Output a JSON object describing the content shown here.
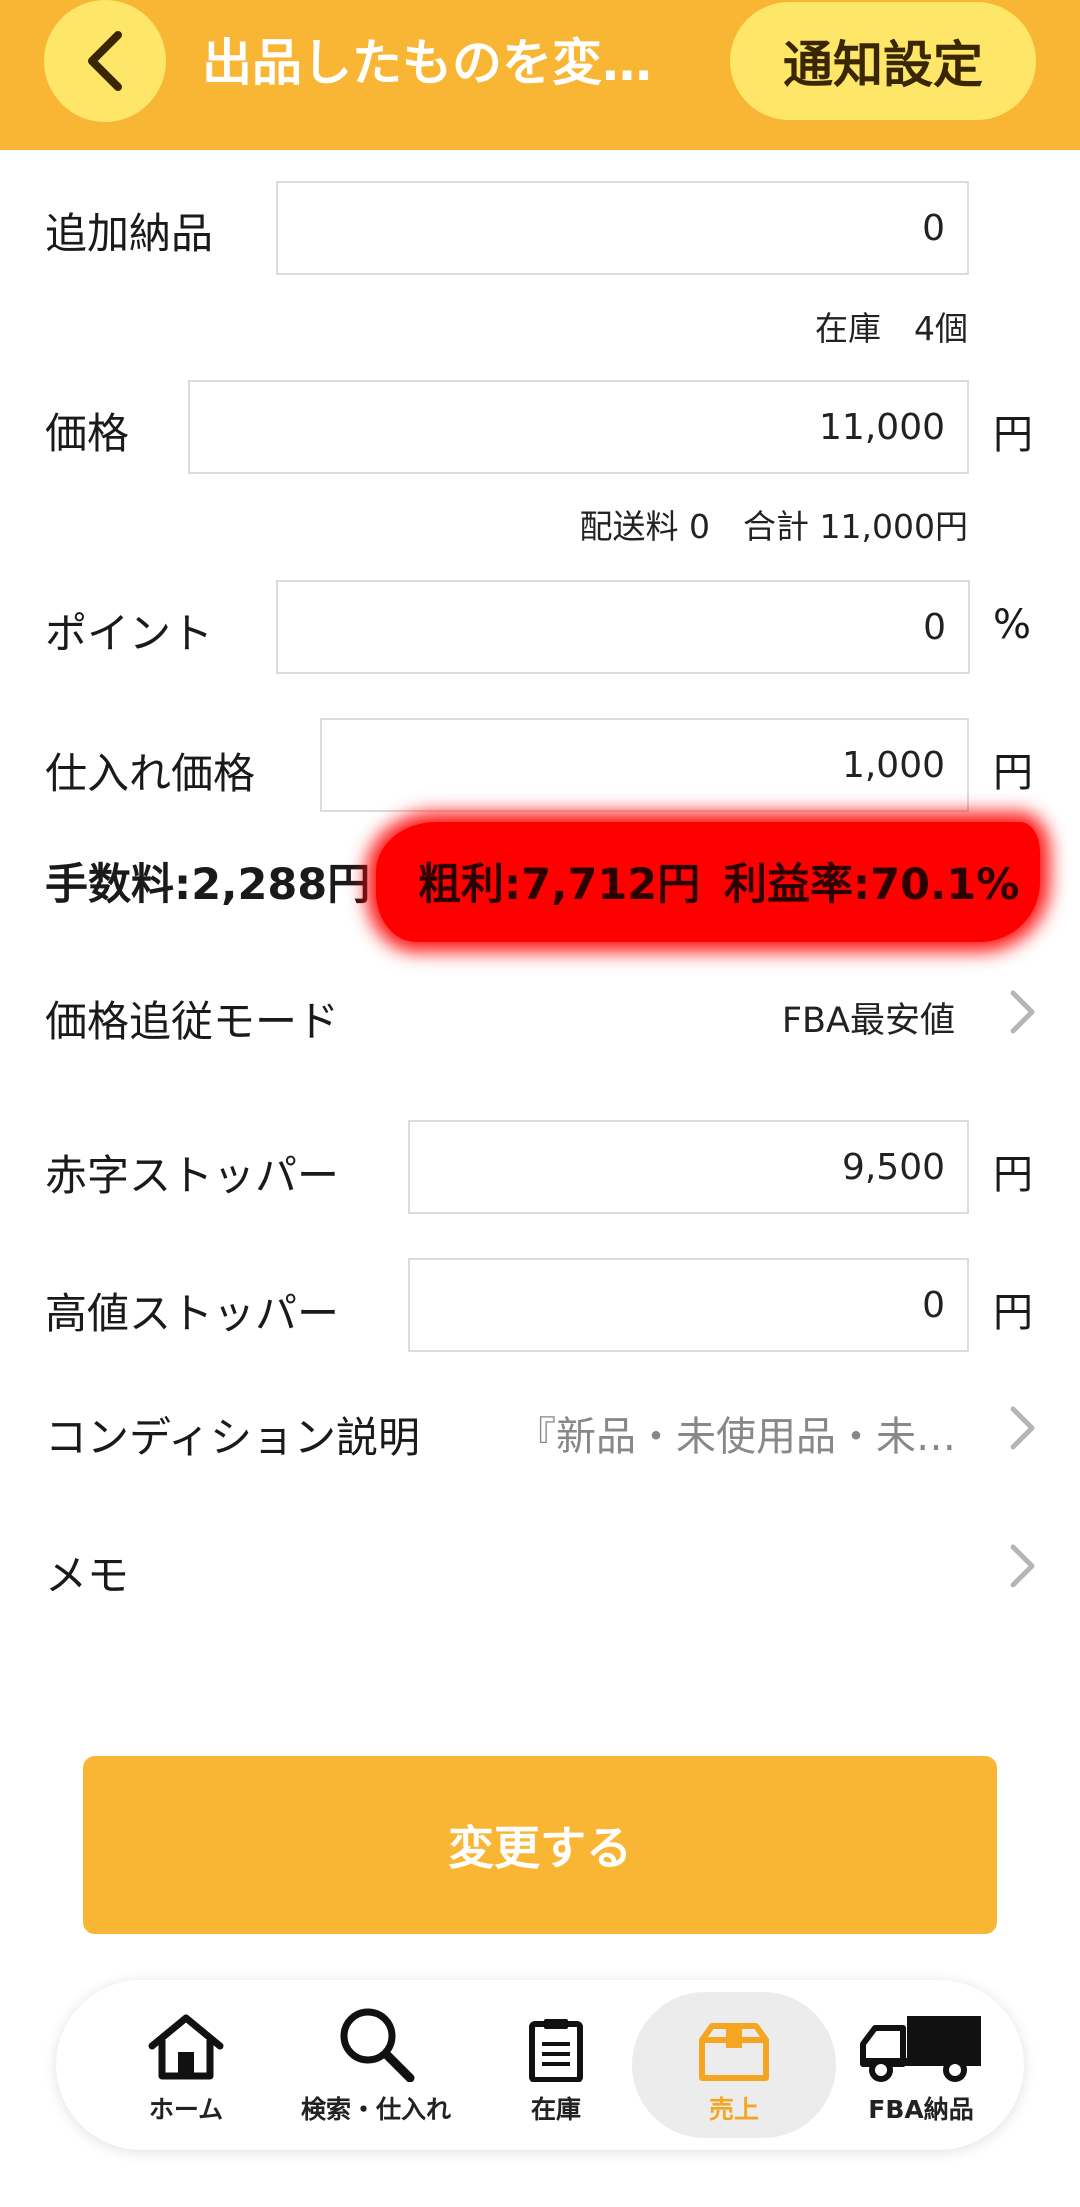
{
  "header": {
    "title": "出品したものを変…",
    "notify_label": "通知設定"
  },
  "form": {
    "additional": {
      "label": "追加納品",
      "value": "0"
    },
    "stock_note": "在庫　4個",
    "price": {
      "label": "価格",
      "value": "11,000",
      "unit": "円"
    },
    "price_note": "配送料 0　合計 11,000円",
    "points": {
      "label": "ポイント",
      "value": "0",
      "unit": "%"
    },
    "purchase": {
      "label": "仕入れ価格",
      "value": "1,000",
      "unit": "円"
    },
    "fee": "手数料:2,288円",
    "gross_profit": "粗利:7,712円",
    "profit_rate": "利益率:70.1%",
    "tracking": {
      "label": "価格追従モード",
      "value": "FBA最安値"
    },
    "loss_stopper": {
      "label": "赤字ストッパー",
      "value": "9,500",
      "unit": "円"
    },
    "high_stopper": {
      "label": "高値ストッパー",
      "value": "0",
      "unit": "円"
    },
    "condition": {
      "label": "コンディション説明",
      "value": "『新品・未使用品・未…"
    },
    "memo": {
      "label": "メモ"
    }
  },
  "submit_label": "変更する",
  "nav": {
    "items": [
      {
        "label": "ホーム",
        "icon": "home-icon"
      },
      {
        "label": "検索・仕入れ",
        "icon": "search-icon"
      },
      {
        "label": "在庫",
        "icon": "clipboard-icon"
      },
      {
        "label": "売上",
        "icon": "box-icon"
      },
      {
        "label": "FBA納品",
        "icon": "truck-icon"
      }
    ],
    "active_index": 3
  },
  "colors": {
    "accent": "#f9b534",
    "accent_light": "#fde668",
    "active_label": "#f4a623",
    "redaction": "#ff0000"
  }
}
